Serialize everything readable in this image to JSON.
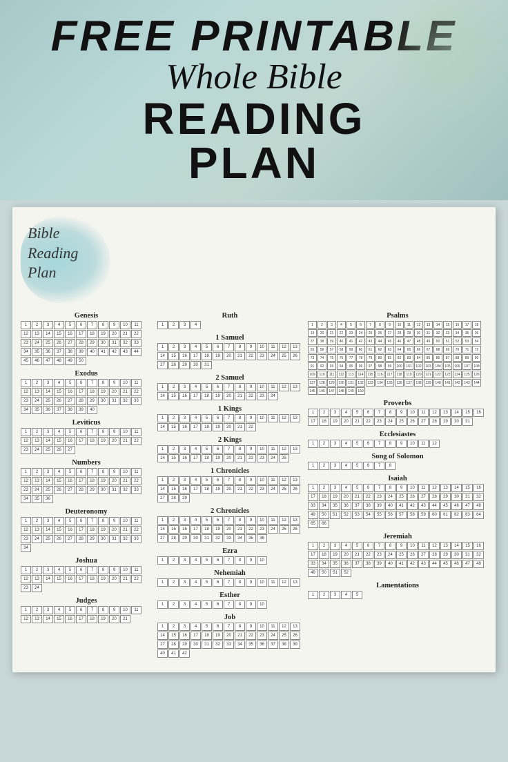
{
  "header": {
    "line1": "FREE PRINTABLE",
    "line2": "Whole Bible",
    "line3": "READING PLAN"
  },
  "logo": {
    "line1": "Bible",
    "line2": "Reading",
    "line3": "Plan"
  },
  "books": {
    "genesis": {
      "title": "Genesis",
      "chapters": 50
    },
    "exodus": {
      "title": "Exodus",
      "chapters": 40
    },
    "leviticus": {
      "title": "Leviticus",
      "chapters": 27
    },
    "numbers": {
      "title": "Numbers",
      "chapters": 36
    },
    "deuteronomy": {
      "title": "Deuteronomy",
      "chapters": 34
    },
    "joshua": {
      "title": "Joshua",
      "chapters": 24
    },
    "judges": {
      "title": "Judges",
      "chapters": 21
    },
    "ruth": {
      "title": "Ruth",
      "chapters": 4
    },
    "samuel1": {
      "title": "1 Samuel",
      "chapters": 31
    },
    "samuel2": {
      "title": "2 Samuel",
      "chapters": 24
    },
    "kings1": {
      "title": "1 Kings",
      "chapters": 22
    },
    "kings2": {
      "title": "2 Kings",
      "chapters": 25
    },
    "chronicles1": {
      "title": "1 Chronicles",
      "chapters": 29
    },
    "chronicles2": {
      "title": "2 Chronicles",
      "chapters": 36
    },
    "ezra": {
      "title": "Ezra",
      "chapters": 10
    },
    "nehemiah": {
      "title": "Nehemiah",
      "chapters": 13
    },
    "esther": {
      "title": "Esther",
      "chapters": 10
    },
    "job": {
      "title": "Job",
      "chapters": 42
    },
    "psalms": {
      "title": "Psalms",
      "chapters": 150
    },
    "proverbs": {
      "title": "Proverbs",
      "chapters": 31
    },
    "ecclesiastes": {
      "title": "Ecclesiastes",
      "chapters": 12
    },
    "songofsolomon": {
      "title": "Song of Solomon",
      "chapters": 8
    },
    "isaiah": {
      "title": "Isaiah",
      "chapters": 66
    },
    "jeremiah": {
      "title": "Jeremiah",
      "chapters": 52
    },
    "lamentations": {
      "title": "Lamentations",
      "chapters": 5
    }
  }
}
